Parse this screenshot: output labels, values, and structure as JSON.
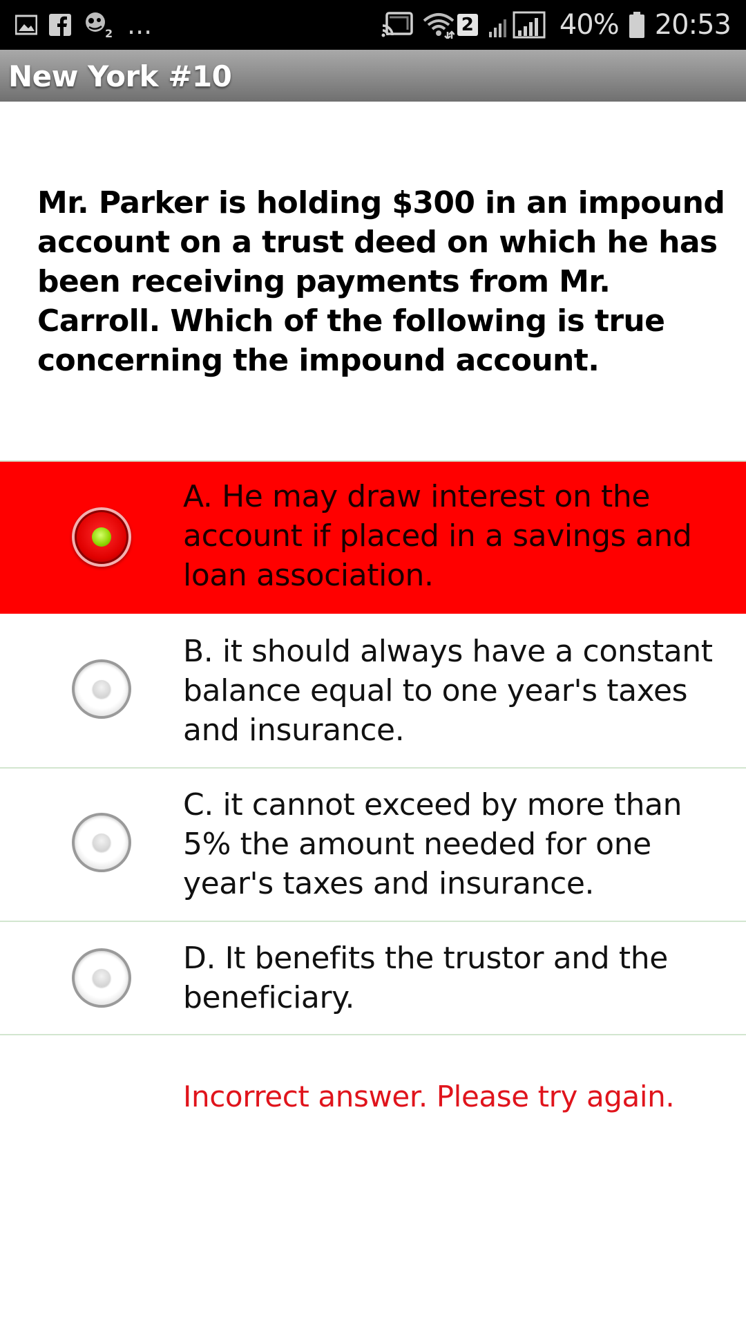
{
  "status_bar": {
    "left_icons": [
      "gallery-icon",
      "facebook-icon",
      "zombie-app-icon"
    ],
    "overflow": "...",
    "right_icons": [
      "cast-icon",
      "wifi-icon",
      "signal-icon"
    ],
    "sim_badge": "2",
    "battery": "40%",
    "time": "20:53"
  },
  "title_bar": {
    "title": "New York #10"
  },
  "question": {
    "text": "Mr. Parker is holding $300 in an impound account on a trust deed on which he has been receiving payments from Mr. Carroll. Which of the following is true concerning the impound account."
  },
  "options": [
    {
      "label": "A. He may draw interest on the account if placed in a savings and loan association.",
      "selected": true,
      "state": "incorrect"
    },
    {
      "label": "B. it should always have a constant balance equal to one year's taxes and insurance.",
      "selected": false
    },
    {
      "label": "C. it cannot exceed by more than 5% the amount needed for one year's taxes and insurance.",
      "selected": false
    },
    {
      "label": "D. It benefits the trustor and the beneficiary.",
      "selected": false
    }
  ],
  "feedback": {
    "text": "Incorrect answer. Please try again."
  },
  "colors": {
    "incorrect_highlight": "#ff0000",
    "feedback_text": "#e0141c",
    "divider": "#d2e6cf",
    "title_bar": "#8a8a8a"
  }
}
